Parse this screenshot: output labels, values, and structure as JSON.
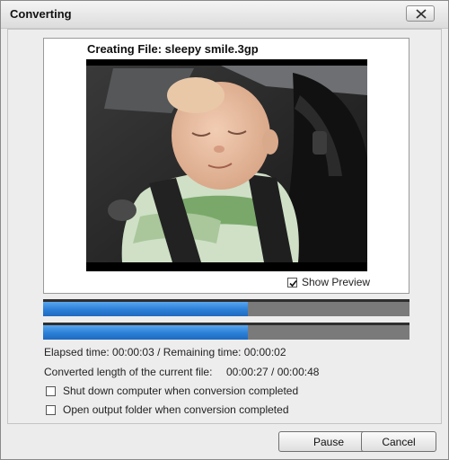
{
  "window": {
    "title": "Converting"
  },
  "preview": {
    "creating_file_label": "Creating File: sleepy smile.3gp",
    "show_preview_label": "Show Preview",
    "show_preview_checked": true
  },
  "progress": {
    "current_file_fraction": 0.56,
    "total_fraction": 0.56,
    "fill_color": "#2a7fd6"
  },
  "stats": {
    "elapsed_line": "Elapsed time:  00:00:03 / Remaining time:  00:00:02",
    "converted_label": "Converted length of the current file:",
    "converted_value": "00:00:27 / 00:00:48"
  },
  "options": {
    "shutdown_label": "Shut down computer when conversion completed",
    "shutdown_checked": false,
    "open_folder_label": "Open output folder when conversion completed",
    "open_folder_checked": false
  },
  "buttons": {
    "pause_label": "Pause",
    "cancel_label": "Cancel"
  },
  "icons": {
    "close": "close-icon",
    "check": "checkmark-icon"
  }
}
